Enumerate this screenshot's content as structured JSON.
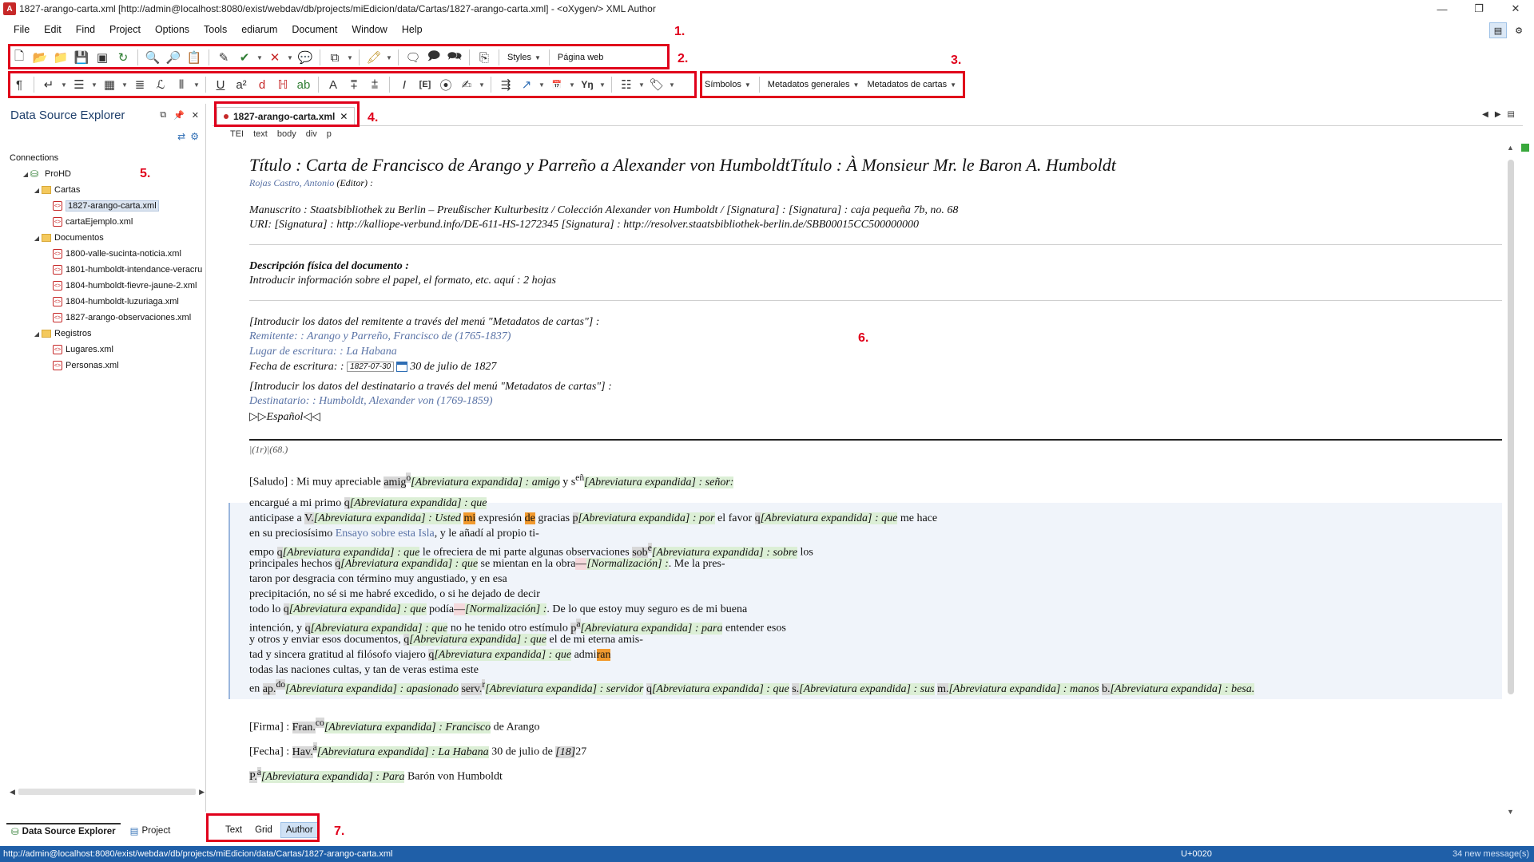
{
  "window": {
    "title": "1827-arango-carta.xml [http://admin@localhost:8080/exist/webdav/db/projects/miEdicion/data/Cartas/1827-arango-carta.xml] - <oXygen/> XML Author",
    "minimize": "—",
    "restore": "❐",
    "close": "✕"
  },
  "menu": [
    "File",
    "Edit",
    "Find",
    "Project",
    "Options",
    "Tools",
    "ediarum",
    "Document",
    "Window",
    "Help"
  ],
  "toolbar1": {
    "styles_label": "Styles",
    "pagina_label": "Página web"
  },
  "toolbar3": {
    "simbolos": "Símbolos",
    "metadatos_generales": "Metadatos generales",
    "metadatos_cartas": "Metadatos de cartas"
  },
  "annotations": [
    "1.",
    "2.",
    "3.",
    "4.",
    "5.",
    "6.",
    "7."
  ],
  "left_panel": {
    "title": "Data Source Explorer",
    "connections": "Connections",
    "tree": [
      {
        "level": 0,
        "type": "label",
        "label": "Connections"
      },
      {
        "level": 1,
        "type": "db",
        "label": "ProHD"
      },
      {
        "level": 2,
        "type": "folder",
        "label": "Cartas"
      },
      {
        "level": 3,
        "type": "xml",
        "label": "1827-arango-carta.xml",
        "selected": true
      },
      {
        "level": 3,
        "type": "xml",
        "label": "cartaEjemplo.xml"
      },
      {
        "level": 2,
        "type": "folder",
        "label": "Documentos"
      },
      {
        "level": 3,
        "type": "xml",
        "label": "1800-valle-sucinta-noticia.xml"
      },
      {
        "level": 3,
        "type": "xml",
        "label": "1801-humboldt-intendance-veracru"
      },
      {
        "level": 3,
        "type": "xml",
        "label": "1804-humboldt-fievre-jaune-2.xml"
      },
      {
        "level": 3,
        "type": "xml",
        "label": "1804-humboldt-luzuriaga.xml"
      },
      {
        "level": 3,
        "type": "xml",
        "label": "1827-arango-observaciones.xml"
      },
      {
        "level": 2,
        "type": "folder",
        "label": "Registros"
      },
      {
        "level": 3,
        "type": "xml",
        "label": "Lugares.xml"
      },
      {
        "level": 3,
        "type": "xml",
        "label": "Personas.xml"
      }
    ],
    "bottom_tabs": [
      "Data Source Explorer",
      "Project"
    ]
  },
  "editor": {
    "tab_label": "1827-arango-carta.xml",
    "breadcrumbs": [
      "TEI",
      "text",
      "body",
      "div",
      "p"
    ],
    "title_line": "Título : Carta de Francisco de Arango y Parreño a Alexander von HumboldtTítulo : À Monsieur Mr. le Baron A. Humboldt",
    "editor_line_name": "Rojas Castro, Antonio",
    "editor_line_role": "(Editor) :",
    "manuscrito": "Manuscrito : Staatsbibliothek zu Berlin – Preußischer Kulturbesitz / Colección Alexander von Humboldt / [Signatura] :  [Signatura] : caja pequeña 7b, no. 68",
    "uri": "URI: [Signatura] : http://kalliope-verbund.info/DE-611-HS-1272345 [Signatura] : http://resolver.staatsbibliothek-berlin.de/SBB00015CC500000000",
    "desc_heading": "Descripción física del documento :",
    "desc_text": "Introducir información sobre el papel, el formato, etc. aquí : 2 hojas",
    "remitente_intro": "[Introducir los datos del remitente a través del menú \"Metadatos de cartas\"] :",
    "remitente": "Remitente: : Arango y Parreño, Francisco de (1765-1837)",
    "lugar": "Lugar de escritura: : La Habana",
    "fecha_label": "Fecha de escritura: :",
    "fecha_input": "1827-07-30",
    "fecha_text": "30 de julio de 1827",
    "dest_intro": "[Introducir los datos del destinatario a través del menú \"Metadatos de cartas\"] :",
    "destinatario": "Destinatario: : Humboldt, Alexander von (1769-1859)",
    "idioma": "▷▷Español◁◁",
    "folio": "|(1r)|(68.)",
    "abbr_label": "[Abreviatura expandida] :",
    "norm_label": "[Normalización] :",
    "saludo": {
      "prefix": "[Saludo] : Mi muy apreciable ",
      "w1": "amig",
      "w1_sup": "o",
      "w1_exp": "amigo",
      "mid": " y s",
      "w2_sup": "eñ",
      "w2_exp": "señor:"
    },
    "body": {
      "l1_pre": "encargué a mi primo ",
      "l1_q": "q",
      "l1_exp": "que",
      "l2_pre": " anticipase a ",
      "l2_v": "V.",
      "l2_exp1": "Usted",
      "l2_mi": "mi",
      "l2_mid": " expresión ",
      "l2_de": "de",
      "l2_mid2": " gracias ",
      "l2_p": "p",
      "l2_exp2": "por",
      "l2_mid3": " el favor ",
      "l2_q": "q",
      "l2_exp3": "que",
      "l2_end": " me hace",
      "l3": " en su preciosísimo ",
      "l3_ens": "Ensayo sobre esta Isla",
      "l3_end": ", y le añadí al propio ti-",
      "l4_pre": "empo ",
      "l4_q": "q",
      "l4_exp": "que",
      "l4_mid": " le ofreciera de mi parte algunas observaciones ",
      "l4_sob": "sob",
      "l4_sup": "e",
      "l4_exp2": "sobre",
      "l4_end": " los",
      "l5_pre": " principales hechos ",
      "l5_q": "q",
      "l5_exp": "que",
      "l5_mid": " se mientan en la obra",
      "l5_norm": "—",
      "l5_end": ". Me la pres-",
      "l6": "taron por desgracia con término muy angustiado, y en esa",
      "l7": " precipitación, no sé si me habré excedido, o si he dejado de decir",
      "l8_pre": " todo lo ",
      "l8_q": "q",
      "l8_exp": "que",
      "l8_mid": " podía",
      "l8_norm": "—",
      "l8_end": ". De lo que estoy muy seguro es de mi buena",
      "l9_pre": " intención, y ",
      "l9_q": "q",
      "l9_exp": "que",
      "l9_mid": " no he tenido otro estímulo ",
      "l9_p": "p",
      "l9_sup": "a",
      "l9_exp2": "para",
      "l9_end": " entender esos",
      "l10_pre": " y otros y enviar esos documentos, ",
      "l10_q": "q",
      "l10_exp": "que",
      "l10_end": " el de mi eterna amis-",
      "l11_pre": "tad y sincera gratitud al filósofo viajero ",
      "l11_q": "q",
      "l11_exp": "que",
      "l11_admi": " admi",
      "l11_ran": "ran",
      "l12": " todas las naciones cultas, y tan de veras estima este",
      "l13_pre": " en ",
      "l13_ap": "ap.",
      "l13_ap_sup": "do",
      "l13_exp1": "apasionado",
      "l13_serv": "serv.",
      "l13_serv_sup": "r",
      "l13_exp2": "servidor",
      "l13_q": "q",
      "l13_exp3": "que",
      "l13_s": "s.",
      "l13_exp4": "sus",
      "l13_m": "m.",
      "l13_exp5": "manos",
      "l13_b": "b.",
      "l13_exp6": "besa."
    },
    "firma": {
      "pre": "[Firma] : ",
      "w": "Fran.",
      "sup": "co",
      "exp": "Francisco",
      "end": " de Arango"
    },
    "fecha": {
      "pre": "[Fecha] : ",
      "w": "Hav.",
      "sup": "a",
      "exp": "La Habana",
      "mid": " 30 de julio de ",
      "yr": "[18]",
      "end": "27"
    },
    "para": {
      "w": "P.",
      "sup": "a",
      "exp": "Para",
      "end": " Barón von Humboldt"
    }
  },
  "modes": [
    "Text",
    "Grid",
    "Author"
  ],
  "active_mode": "Author",
  "status": {
    "path": "http://admin@localhost:8080/exist/webdav/db/projects/miEdicion/data/Cartas/1827-arango-carta.xml",
    "unicode": "U+0020",
    "messages": "34 new message(s)"
  },
  "colors": {
    "annotation_red": "#e0001b",
    "status_blue": "#1f5fa8",
    "abbr_green": "#dcefd6",
    "highlight_orange": "#f29a2e"
  }
}
